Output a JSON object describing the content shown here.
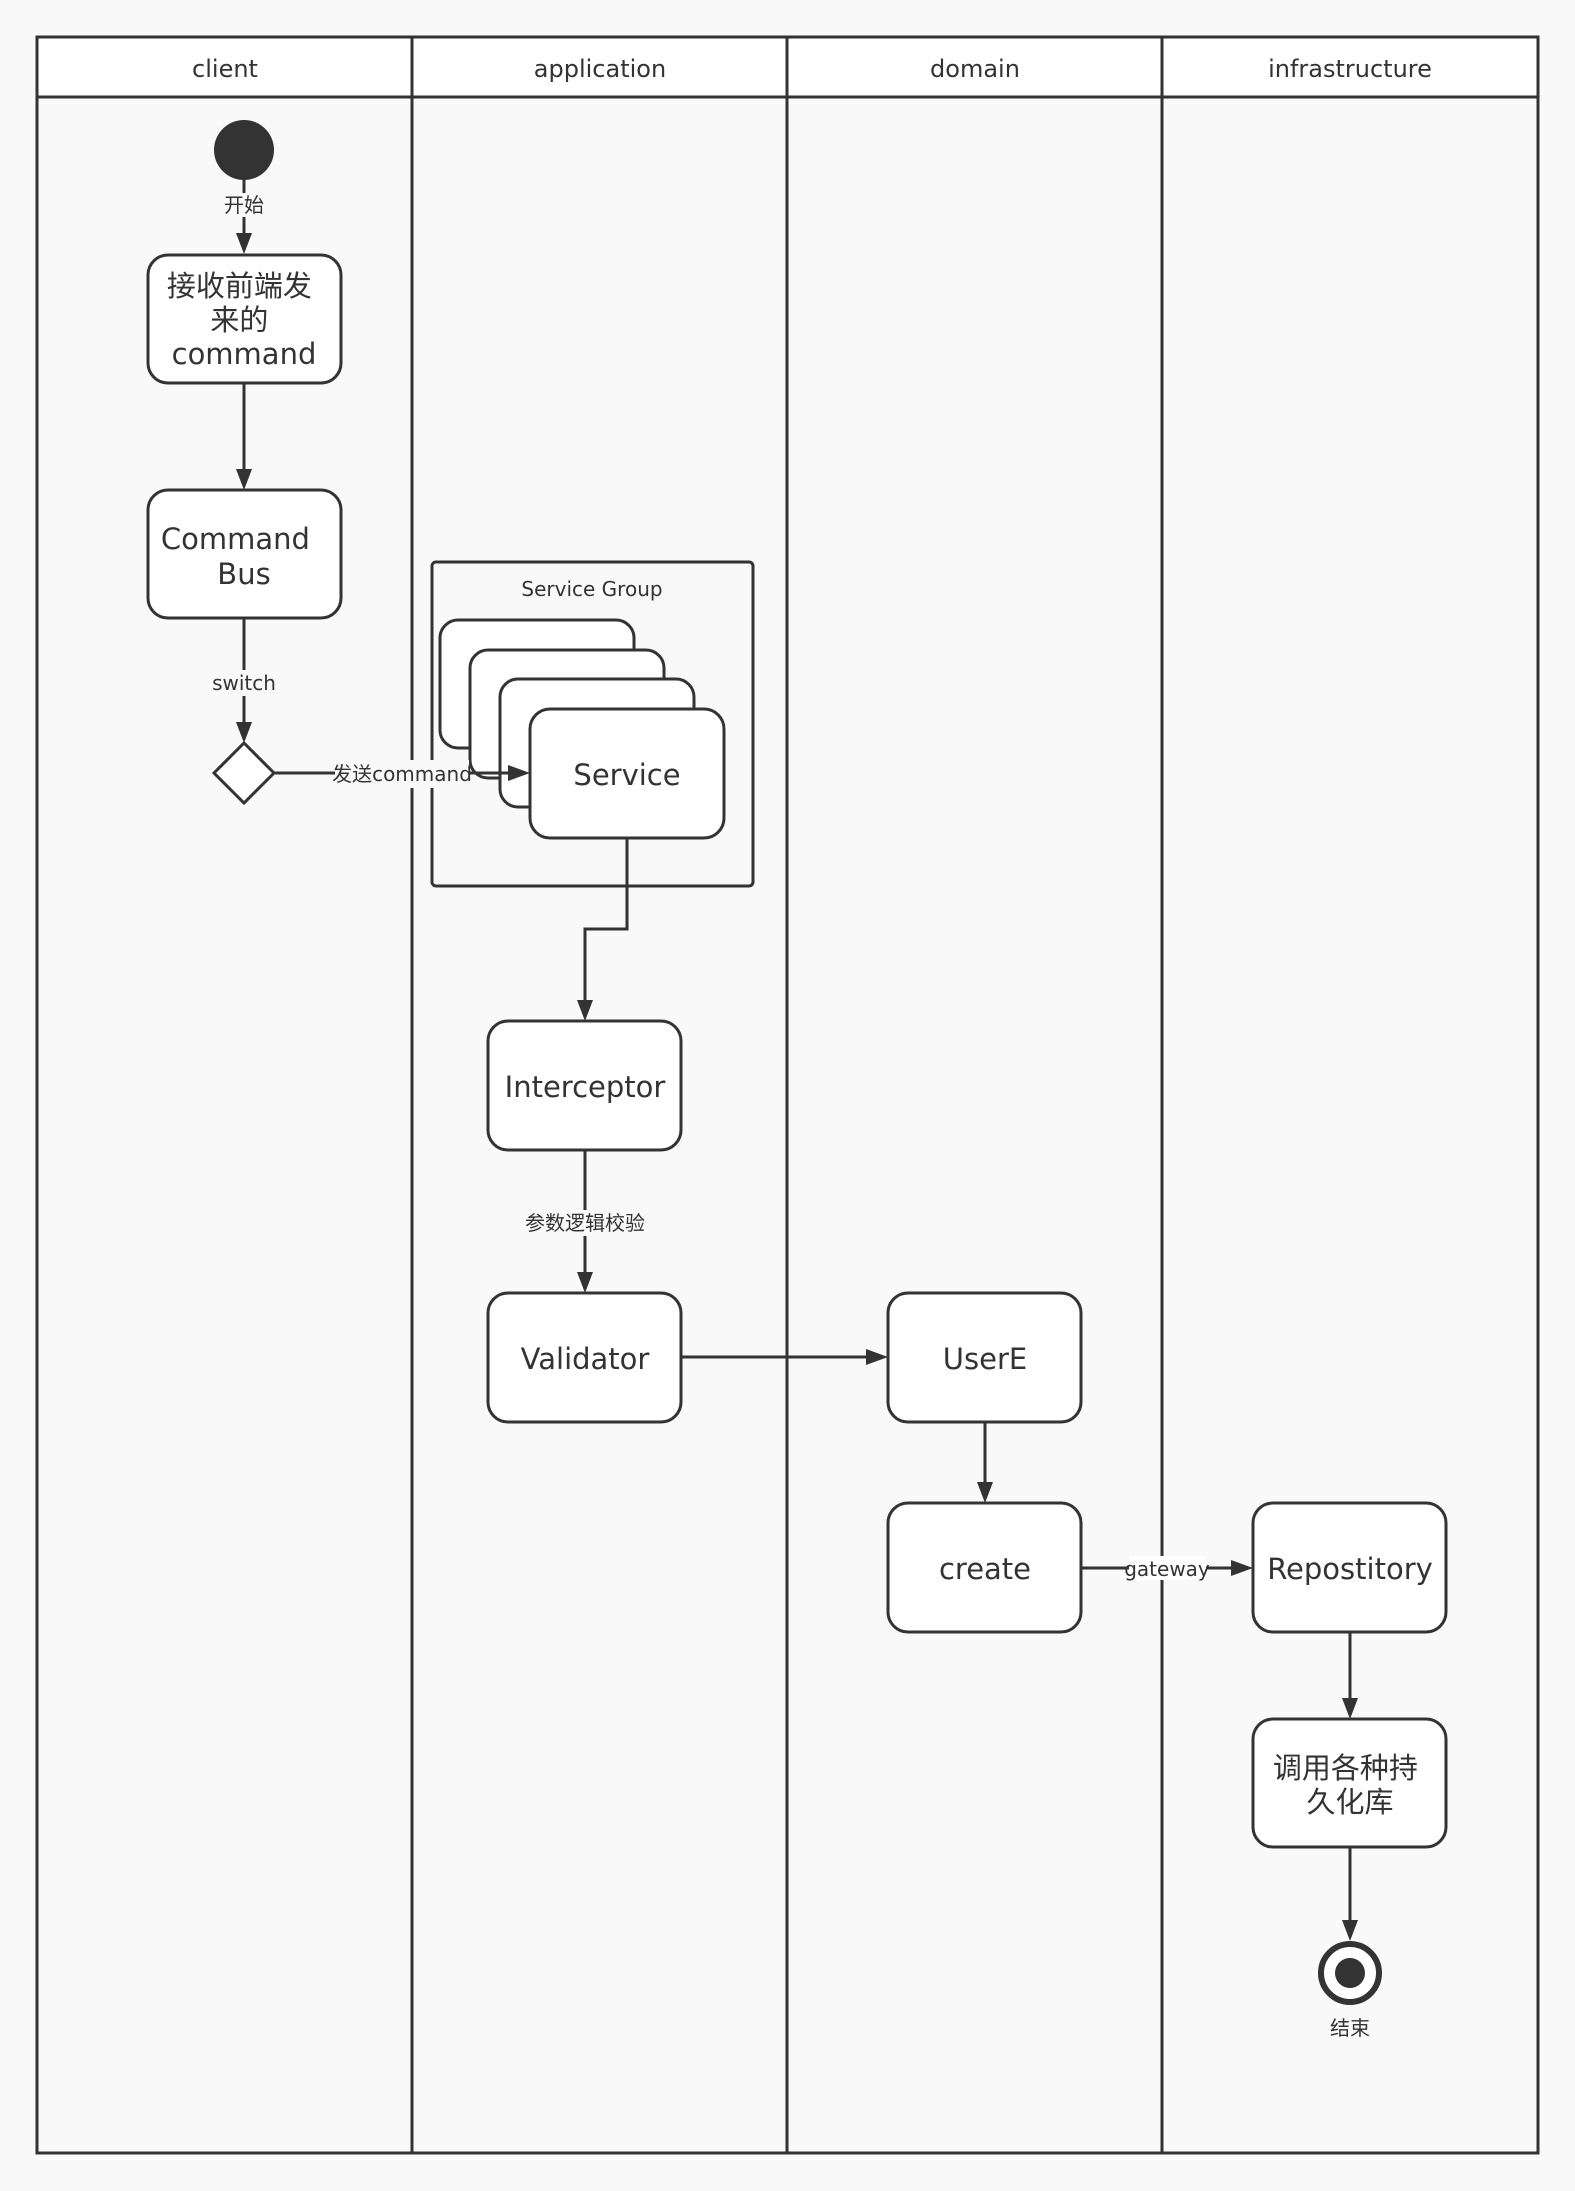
{
  "swimlanes": [
    {
      "title": "client"
    },
    {
      "title": "application"
    },
    {
      "title": "domain"
    },
    {
      "title": "infrastructure"
    }
  ],
  "nodes": {
    "start": {
      "label": "开始"
    },
    "receive": {
      "lines": [
        "接收前端发",
        "来的",
        "command"
      ]
    },
    "command_bus": {
      "lines": [
        "Command",
        "Bus"
      ]
    },
    "service_group": {
      "title": "Service Group"
    },
    "service": {
      "label": "Service"
    },
    "interceptor": {
      "label": "Interceptor"
    },
    "validator": {
      "label": "Validator"
    },
    "usere": {
      "label": "UserE"
    },
    "create": {
      "label": "create"
    },
    "repository": {
      "label": "Repostitory"
    },
    "persist": {
      "lines": [
        "调用各种持",
        "久化库"
      ]
    },
    "end": {
      "label": "结束"
    }
  },
  "edges": {
    "switch": "switch",
    "send_command": "发送command",
    "validate": "参数逻辑校验",
    "gateway": "gateway"
  },
  "colors": {
    "stroke": "#333333",
    "background": "#f9f9f9",
    "box": "#ffffff"
  }
}
